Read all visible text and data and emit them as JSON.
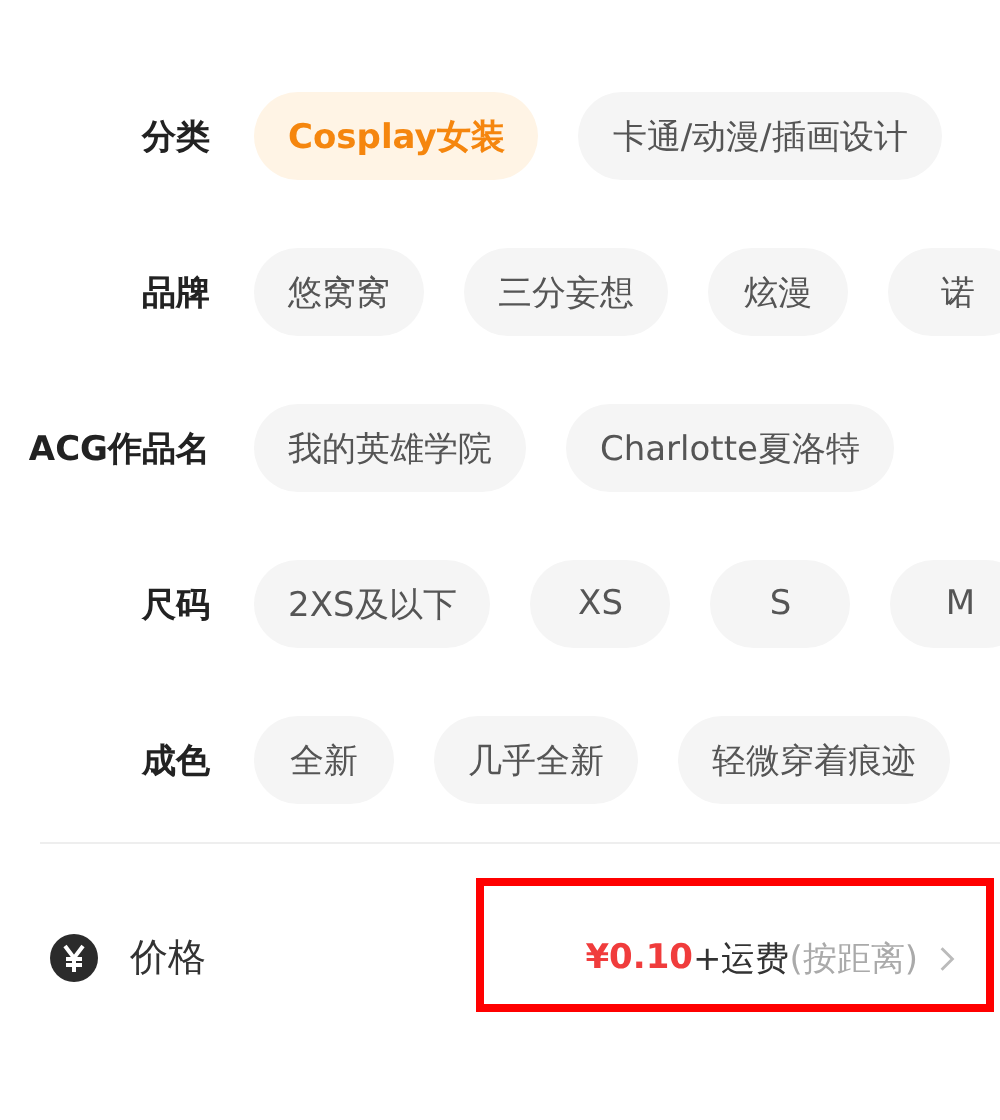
{
  "filters": [
    {
      "label": "分类",
      "options": [
        {
          "label": "Cosplay女装",
          "selected": true
        },
        {
          "label": "卡通/动漫/插画设计",
          "selected": false
        }
      ]
    },
    {
      "label": "品牌",
      "options": [
        {
          "label": "悠窝窝",
          "selected": false
        },
        {
          "label": "三分妄想",
          "selected": false
        },
        {
          "label": "炫漫",
          "selected": false
        },
        {
          "label": "诺",
          "selected": false
        }
      ]
    },
    {
      "label": "ACG作品名",
      "options": [
        {
          "label": "我的英雄学院",
          "selected": false
        },
        {
          "label": "Charlotte夏洛特",
          "selected": false
        }
      ]
    },
    {
      "label": "尺码",
      "options": [
        {
          "label": "2XS及以下",
          "selected": false
        },
        {
          "label": "XS",
          "selected": false
        },
        {
          "label": "S",
          "selected": false
        },
        {
          "label": "M",
          "selected": false
        }
      ]
    },
    {
      "label": "成色",
      "options": [
        {
          "label": "全新",
          "selected": false
        },
        {
          "label": "几乎全新",
          "selected": false
        },
        {
          "label": "轻微穿着痕迹",
          "selected": false
        }
      ]
    }
  ],
  "price": {
    "label": "价格",
    "amount": "¥0.10",
    "shipping": "+运费",
    "note": "(按距离)",
    "highlighted": true
  }
}
